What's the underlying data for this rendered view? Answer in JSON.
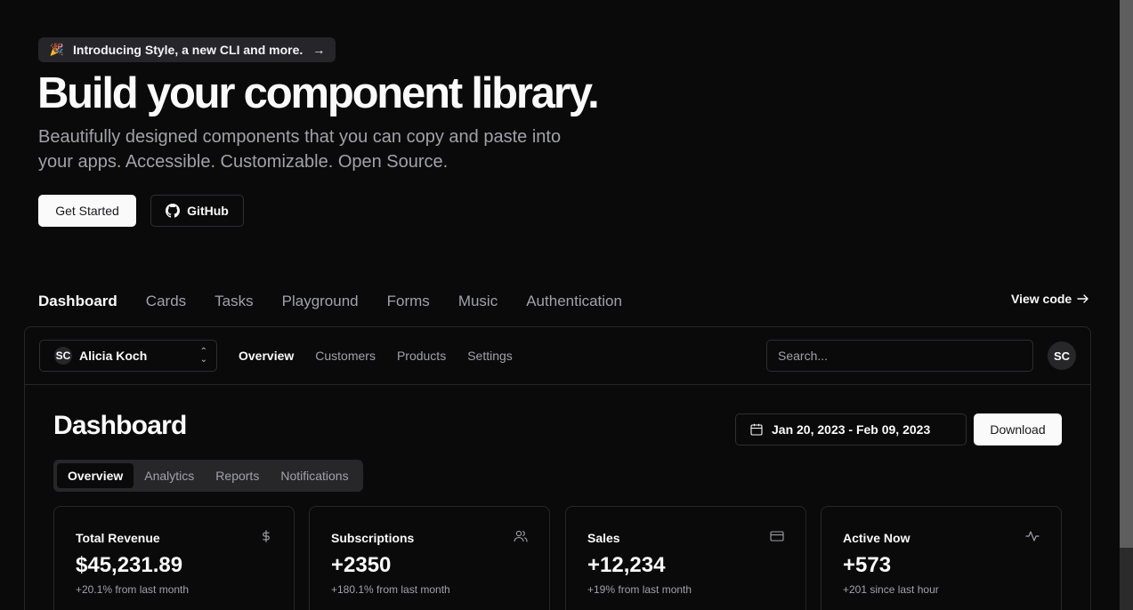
{
  "hero": {
    "announcement": "Introducing Style, a new CLI and more.",
    "announcement_arrow": "→",
    "title": "Build your component library.",
    "subtitle": "Beautifully designed components that you can copy and paste into your apps. Accessible. Customizable. Open Source.",
    "get_started": "Get Started",
    "github": "GitHub"
  },
  "example_tabs": [
    "Dashboard",
    "Cards",
    "Tasks",
    "Playground",
    "Forms",
    "Music",
    "Authentication"
  ],
  "view_code": "View code",
  "topbar": {
    "team_initials": "SC",
    "team_name": "Alicia Koch",
    "nav": [
      "Overview",
      "Customers",
      "Products",
      "Settings"
    ],
    "search_placeholder": "Search...",
    "user_initials": "SC"
  },
  "dashboard": {
    "title": "Dashboard",
    "date_range": "Jan 20, 2023 - Feb 09, 2023",
    "download": "Download",
    "tabs": [
      "Overview",
      "Analytics",
      "Reports",
      "Notifications"
    ],
    "cards": [
      {
        "title": "Total Revenue",
        "icon": "dollar-icon",
        "value": "$45,231.89",
        "note": "+20.1% from last month"
      },
      {
        "title": "Subscriptions",
        "icon": "users-icon",
        "value": "+2350",
        "note": "+180.1% from last month"
      },
      {
        "title": "Sales",
        "icon": "credit-card-icon",
        "value": "+12,234",
        "note": "+19% from last month"
      },
      {
        "title": "Active Now",
        "icon": "activity-icon",
        "value": "+573",
        "note": "+201 since last hour"
      }
    ]
  }
}
